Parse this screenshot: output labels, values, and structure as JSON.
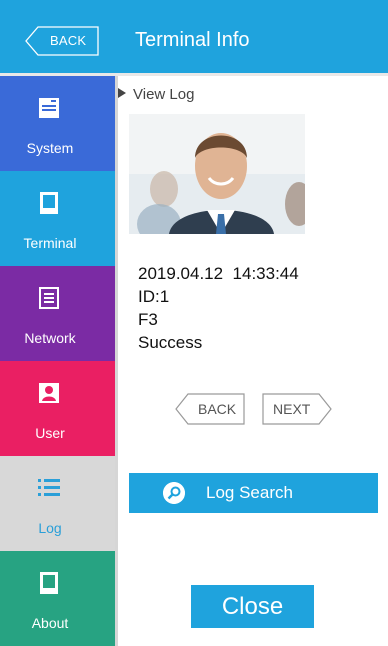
{
  "header": {
    "back_label": "BACK",
    "title": "Terminal Info"
  },
  "sidebar": {
    "items": [
      {
        "label": "System",
        "icon": "system-icon",
        "color": "#3a6ad8"
      },
      {
        "label": "Terminal",
        "icon": "terminal-icon",
        "color": "#1fa3dd"
      },
      {
        "label": "Network",
        "icon": "network-icon",
        "color": "#7b2ba4"
      },
      {
        "label": "User",
        "icon": "user-icon",
        "color": "#ea1f63"
      },
      {
        "label": "Log",
        "icon": "list-icon",
        "color": "#d8d8d8",
        "active": true
      },
      {
        "label": "About",
        "icon": "about-icon",
        "color": "#27a382"
      }
    ]
  },
  "main": {
    "section_title": "View Log",
    "log": {
      "datetime": "2019.04.12  14:33:44",
      "id": "ID:1",
      "key": "F3",
      "status": "Success"
    },
    "pager": {
      "back_label": "BACK",
      "next_label": "NEXT"
    },
    "search_label": "Log Search",
    "close_label": "Close"
  }
}
